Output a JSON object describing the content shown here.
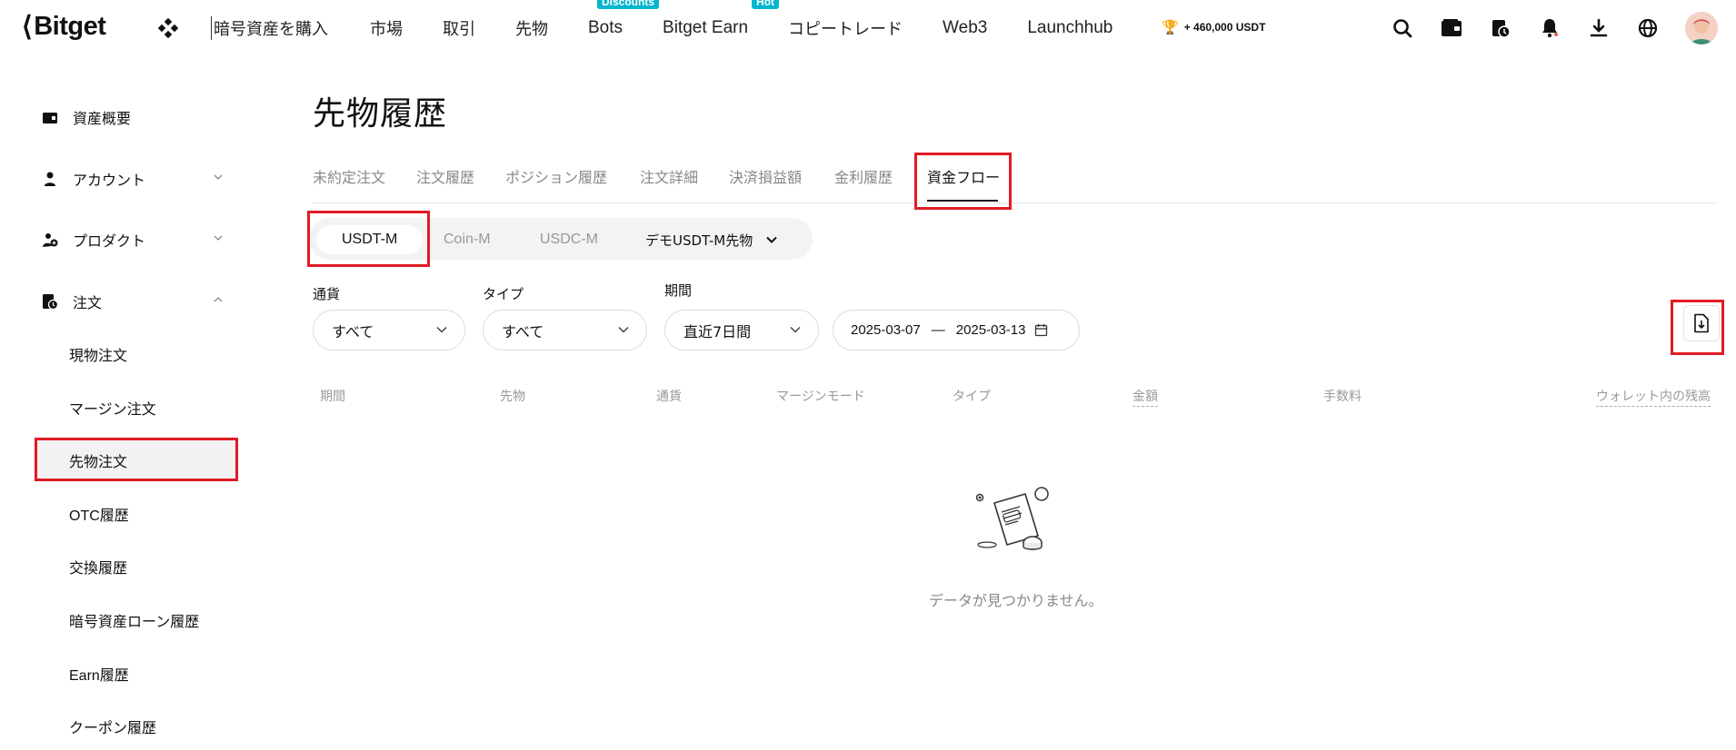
{
  "brand": {
    "name": "Bitget"
  },
  "nav": {
    "items": [
      {
        "label": "暗号資産を購入"
      },
      {
        "label": "市場"
      },
      {
        "label": "取引"
      },
      {
        "label": "先物"
      },
      {
        "label": "Bots",
        "badge": "Discounts"
      },
      {
        "label": "Bitget Earn",
        "badge": "Hot"
      },
      {
        "label": "コピートレード"
      },
      {
        "label": "Web3"
      },
      {
        "label": "Launchhub"
      }
    ],
    "reward": "+ 460,000 USDT",
    "icons": [
      "search-icon",
      "wallet-icon",
      "orders-icon",
      "bell-icon",
      "download-icon",
      "globe-icon",
      "avatar"
    ]
  },
  "sidebar": {
    "items": [
      {
        "label": "資産概要",
        "icon": "wallet-icon"
      },
      {
        "label": "アカウント",
        "icon": "person-icon"
      },
      {
        "label": "プロダクト",
        "icon": "product-icon"
      },
      {
        "label": "注文",
        "icon": "orders-icon"
      }
    ],
    "sub_items": [
      {
        "label": "現物注文"
      },
      {
        "label": "マージン注文"
      },
      {
        "label": "先物注文"
      },
      {
        "label": "OTC履歴"
      },
      {
        "label": "交換履歴"
      },
      {
        "label": "暗号資産ローン履歴"
      },
      {
        "label": "Earn履歴"
      },
      {
        "label": "クーポン履歴"
      }
    ]
  },
  "main": {
    "title": "先物履歴",
    "tabs": [
      {
        "label": "未約定注文"
      },
      {
        "label": "注文履歴"
      },
      {
        "label": "ポジション履歴"
      },
      {
        "label": "注文詳細"
      },
      {
        "label": "決済損益額"
      },
      {
        "label": "金利履歴"
      },
      {
        "label": "資金フロー",
        "active": true
      }
    ],
    "segments": [
      {
        "label": "USDT-M",
        "active": true
      },
      {
        "label": "Coin-M"
      },
      {
        "label": "USDC-M"
      },
      {
        "label": "デモUSDT-M先物"
      }
    ],
    "filters": {
      "currency": {
        "label": "通貨",
        "value": "すべて"
      },
      "type": {
        "label": "タイプ",
        "value": "すべて"
      },
      "period": {
        "label": "期間",
        "value": "直近7日間"
      },
      "date_from": "2025-03-07",
      "date_sep": "—",
      "date_to": "2025-03-13"
    },
    "columns": [
      {
        "label": "期間"
      },
      {
        "label": "先物"
      },
      {
        "label": "通貨"
      },
      {
        "label": "マージンモード"
      },
      {
        "label": "タイプ"
      },
      {
        "label": "金額"
      },
      {
        "label": "手数料"
      },
      {
        "label": "ウォレット内の残高"
      }
    ],
    "empty_text": "データが見つかりません。"
  },
  "colors": {
    "highlight": "#e01b24",
    "badge": "#00b6cf",
    "muted": "#999999"
  }
}
